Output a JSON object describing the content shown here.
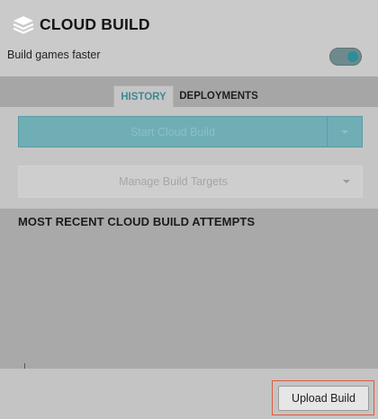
{
  "header": {
    "title": "CLOUD BUILD",
    "subtitle": "Build games faster",
    "logo_icon": "cloud-build-layers-icon",
    "toggle_state": "on"
  },
  "tabs": [
    {
      "label": "HISTORY",
      "active": true
    },
    {
      "label": "DEPLOYMENTS",
      "active": false
    }
  ],
  "actions": {
    "start_label": "Start Cloud Build",
    "manage_label": "Manage Build Targets"
  },
  "history": {
    "section_title": "MOST RECENT CLOUD BUILD ATTEMPTS"
  },
  "footer": {
    "upload_label": "Upload Build"
  },
  "colors": {
    "accent": "#6faeb5",
    "active_tab_text": "#3d8a94",
    "highlight_outline": "#e05a3c"
  }
}
